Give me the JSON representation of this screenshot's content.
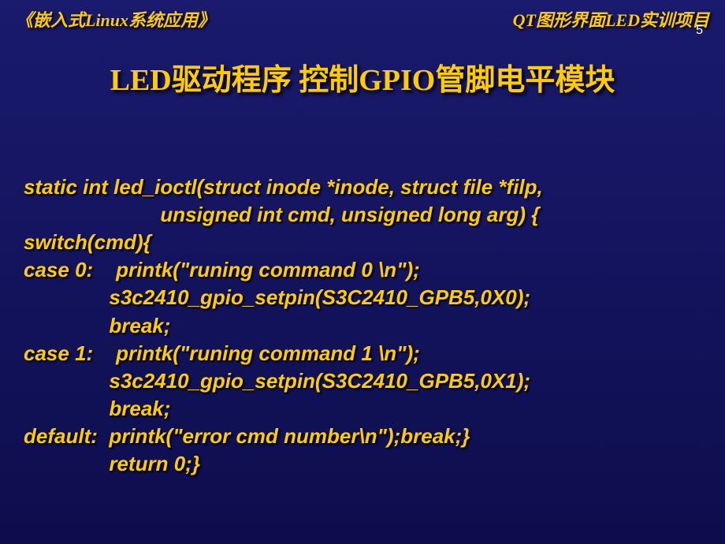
{
  "header": {
    "left": "《嵌入式Linux系统应用》",
    "right": "QT图形界面LED实训项目"
  },
  "page_number": "5",
  "title": "LED驱动程序  控制GPIO管脚电平模块",
  "code": {
    "line1": "static int led_ioctl(struct inode *inode, struct file *filp,",
    "line2": "                        unsigned int cmd, unsigned long arg) {",
    "line3": "switch(cmd){",
    "line4": "case 0:    printk(\"runing command 0 \\n\");",
    "line5": "               s3c2410_gpio_setpin(S3C2410_GPB5,0X0);",
    "line6": "               break;",
    "line7": "case 1:    printk(\"runing command 1 \\n\");",
    "line8": "               s3c2410_gpio_setpin(S3C2410_GPB5,0X1);",
    "line9": "               break;",
    "line10": "default:  printk(\"error cmd number\\n\");break;}",
    "line11": "               return 0;}"
  }
}
